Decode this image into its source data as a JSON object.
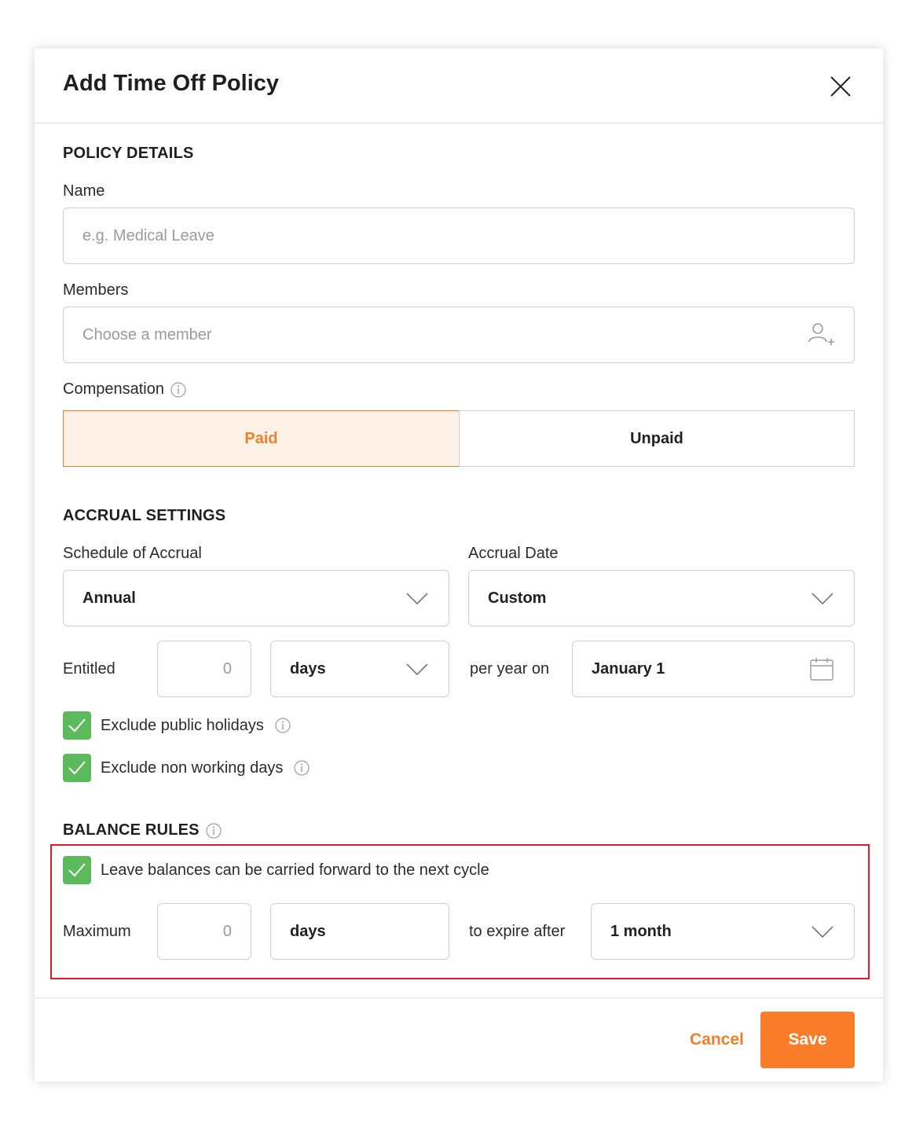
{
  "modal": {
    "title": "Add Time Off Policy",
    "policy_details": {
      "heading": "POLICY DETAILS",
      "name_label": "Name",
      "name_placeholder": "e.g. Medical Leave",
      "members_label": "Members",
      "members_placeholder": "Choose a member",
      "compensation_label": "Compensation",
      "compensation_options": [
        "Paid",
        "Unpaid"
      ],
      "compensation_selected": "Paid"
    },
    "accrual_settings": {
      "heading": "ACCRUAL SETTINGS",
      "schedule_label": "Schedule of Accrual",
      "schedule_value": "Annual",
      "date_label": "Accrual Date",
      "date_value": "Custom",
      "entitled_label": "Entitled",
      "entitled_value": "0",
      "entitled_unit": "days",
      "per_year_label": "per year on",
      "per_year_date": "January 1",
      "exclude_public_holidays": "Exclude public holidays",
      "exclude_non_working_days": "Exclude non working days"
    },
    "balance_rules": {
      "heading": "BALANCE RULES",
      "carry_forward_label": "Leave balances can be carried forward to the next cycle",
      "maximum_label": "Maximum",
      "maximum_value": "0",
      "maximum_unit": "days",
      "expire_label": "to expire after",
      "expire_value": "1 month"
    },
    "footer": {
      "cancel": "Cancel",
      "save": "Save"
    }
  },
  "colors": {
    "accent": "#fb7d29",
    "accent_light": "#fff1e6",
    "check_green": "#5cba5c",
    "highlight_red": "#e01b24"
  }
}
